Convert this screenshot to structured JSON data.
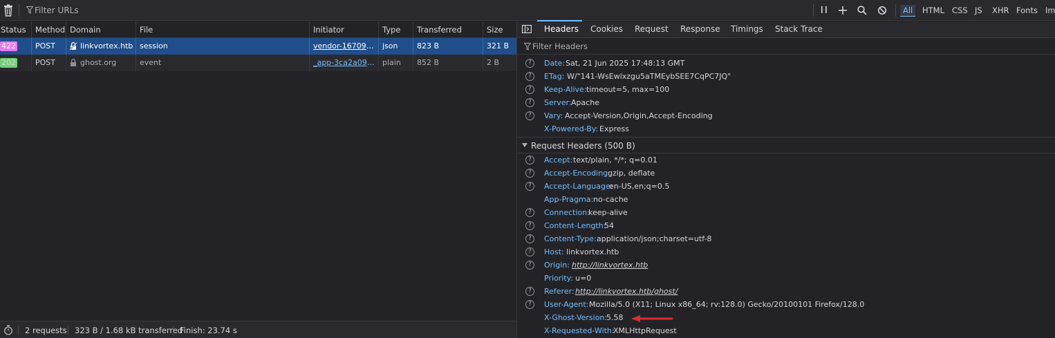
{
  "toolbar": {
    "filter_placeholder": "Filter URLs",
    "type_filters": [
      "All",
      "HTML",
      "CSS",
      "JS",
      "XHR",
      "Fonts",
      "Ima"
    ],
    "active_filter": "All",
    "icons": [
      "trash-icon",
      "filter-icon",
      "pause-icon",
      "plus-icon",
      "search-icon",
      "block-icon"
    ]
  },
  "list": {
    "columns": [
      "Status",
      "Method",
      "Domain",
      "File",
      "Initiator",
      "Type",
      "Transferred",
      "Size"
    ],
    "rows": [
      {
        "status": "422",
        "method": "POST",
        "domain": "linkvortex.htb",
        "file": "session",
        "initiator": "vendor-16709e…",
        "type": "json",
        "transferred": "823 B",
        "size": "321 B"
      },
      {
        "status": "202",
        "method": "POST",
        "domain": "ghost.org",
        "file": "event",
        "initiator": "_app-3ca2a09b…",
        "type": "plain",
        "transferred": "852 B",
        "size": "2 B"
      }
    ]
  },
  "statusbar": {
    "requests": "2 requests",
    "transferred": "323 B / 1.68 kB transferred",
    "finish": "Finish: 23.74 s"
  },
  "details": {
    "tabs": [
      "Headers",
      "Cookies",
      "Request",
      "Response",
      "Timings",
      "Stack Trace"
    ],
    "active_tab": "Headers",
    "filter_placeholder": "Filter Headers",
    "response_headers": [
      {
        "k": "Date:",
        "v": "Sat, 21 Jun 2025 17:48:13 GMT",
        "help": true
      },
      {
        "k": "ETag:",
        "v": "W/\"141-WsEwlxzgu5aTMEybSEE7CqPC7JQ\"",
        "help": true
      },
      {
        "k": "Keep-Alive:",
        "v": "timeout=5, max=100",
        "help": true
      },
      {
        "k": "Server:",
        "v": "Apache",
        "help": true
      },
      {
        "k": "Vary:",
        "v": "Accept-Version,Origin,Accept-Encoding",
        "help": true
      },
      {
        "k": "X-Powered-By:",
        "v": "Express",
        "help": false
      }
    ],
    "request_section": "Request Headers (500 B)",
    "request_headers": [
      {
        "k": "Accept:",
        "v": "text/plain, */*; q=0.01",
        "help": true
      },
      {
        "k": "Accept-Encoding:",
        "v": "gzip, deflate",
        "help": true
      },
      {
        "k": "Accept-Language:",
        "v": "en-US,en;q=0.5",
        "help": true
      },
      {
        "k": "App-Pragma:",
        "v": "no-cache",
        "help": false
      },
      {
        "k": "Connection:",
        "v": "keep-alive",
        "help": true
      },
      {
        "k": "Content-Length:",
        "v": "54",
        "help": true
      },
      {
        "k": "Content-Type:",
        "v": "application/json;charset=utf-8",
        "help": true
      },
      {
        "k": "Host:",
        "v": "linkvortex.htb",
        "help": true
      },
      {
        "k": "Origin:",
        "v": "http://linkvortex.htb",
        "help": true,
        "link": true
      },
      {
        "k": "Priority:",
        "v": "u=0",
        "help": false
      },
      {
        "k": "Referer:",
        "v": "http://linkvortex.htb/ghost/",
        "help": true,
        "link": true
      },
      {
        "k": "User-Agent:",
        "v": "Mozilla/5.0 (X11; Linux x86_64; rv:128.0) Gecko/20100101 Firefox/128.0",
        "help": true
      },
      {
        "k": "X-Ghost-Version:",
        "v": "5.58",
        "help": false
      },
      {
        "k": "X-Requested-With:",
        "v": "XMLHttpRequest",
        "help": false
      }
    ],
    "annotation_color": "#d92d2d"
  }
}
